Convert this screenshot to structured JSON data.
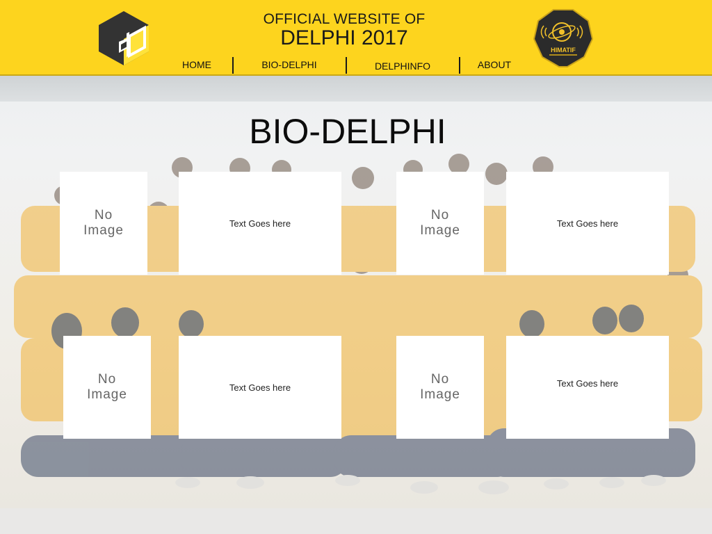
{
  "header": {
    "title_line1": "OFFICIAL WEBSITE OF",
    "title_line2": "DELPHI 2017",
    "badge_text": "HIMATIF",
    "colors": {
      "header_bg": "#fdd41e",
      "logo_face": "#3a3a3a",
      "logo_side": "#ffde26"
    }
  },
  "nav": {
    "items": [
      "HOME",
      "BIO-DELPHI",
      "DELPHINFO",
      "ABOUT"
    ]
  },
  "main": {
    "title": "BIO-DELPHI",
    "cards": [
      {
        "image_placeholder": "No Image",
        "text": "Text Goes here"
      },
      {
        "image_placeholder": "No Image",
        "text": "Text Goes here"
      },
      {
        "image_placeholder": "No Image",
        "text": "Text Goes here"
      },
      {
        "image_placeholder": "No Image",
        "text": "Text Goes here"
      }
    ]
  },
  "background": {
    "description_icon": "group-photo",
    "jacket_color": "#f2b43a"
  }
}
